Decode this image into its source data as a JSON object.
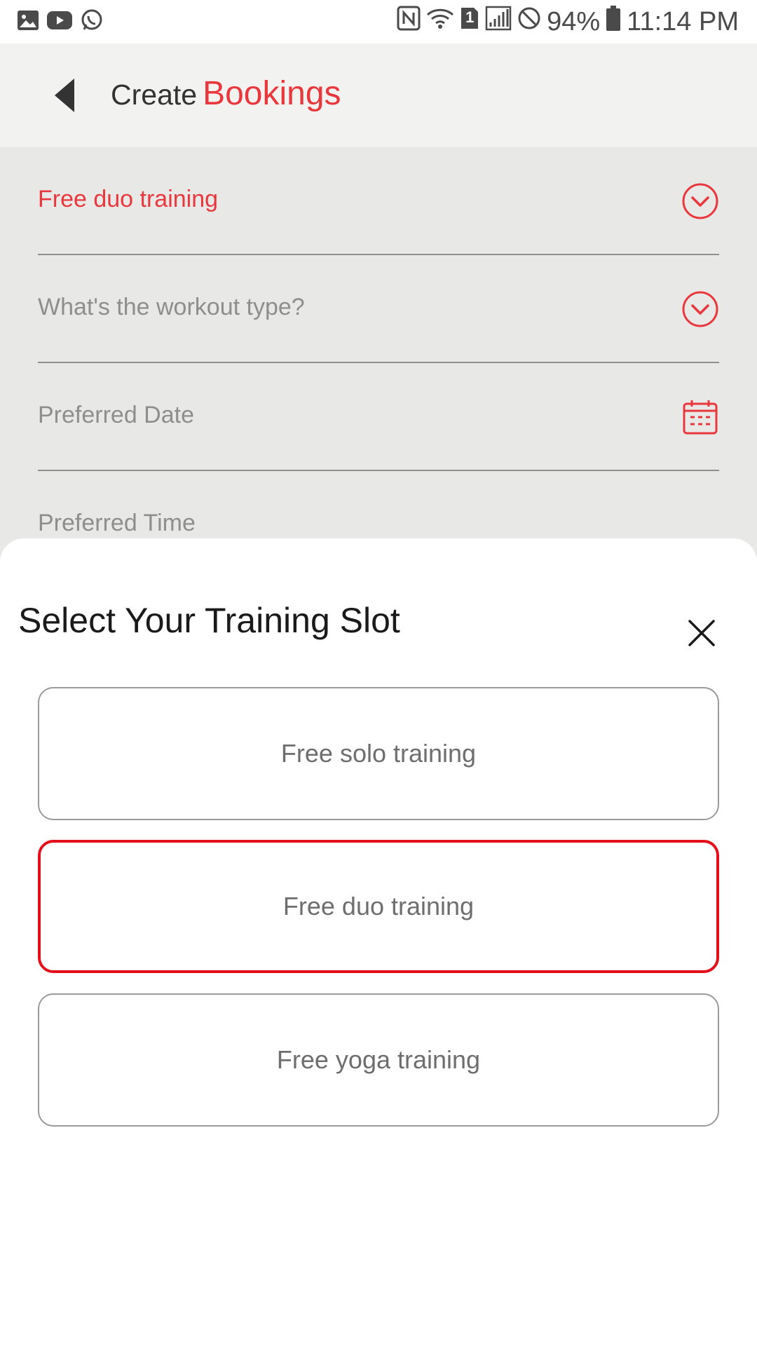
{
  "status_bar": {
    "battery": "94%",
    "time": "11:14 PM",
    "sim": "1",
    "left_icons": [
      "image-icon",
      "youtube-icon",
      "whatsapp-icon"
    ],
    "right_icons": [
      "nfc-icon",
      "wifi-icon",
      "sim-icon",
      "signal-icon",
      "do-not-disturb-icon",
      "battery-icon"
    ]
  },
  "header": {
    "title_prefix": "Create",
    "title_accent": "Bookings",
    "back_icon": "back-arrow-icon"
  },
  "form": {
    "fields": [
      {
        "label": "Free duo training",
        "icon": "chevron-down-circle-icon",
        "selected": true
      },
      {
        "label": "What's the workout type?",
        "icon": "chevron-down-circle-icon",
        "selected": false
      },
      {
        "label": "Preferred Date",
        "icon": "calendar-icon",
        "selected": false
      },
      {
        "label": "Preferred Time",
        "icon": "",
        "selected": false
      }
    ]
  },
  "sheet": {
    "title": "Select Your Training Slot",
    "close_icon": "close-icon",
    "options": [
      {
        "label": "Free solo training",
        "selected": false
      },
      {
        "label": "Free duo training",
        "selected": true
      },
      {
        "label": "Free yoga training",
        "selected": false
      }
    ]
  },
  "colors": {
    "accent": "#e8383d",
    "selected_border": "#e3101b",
    "header_bg": "#f2f2f1",
    "form_bg": "#e8e8e7"
  }
}
